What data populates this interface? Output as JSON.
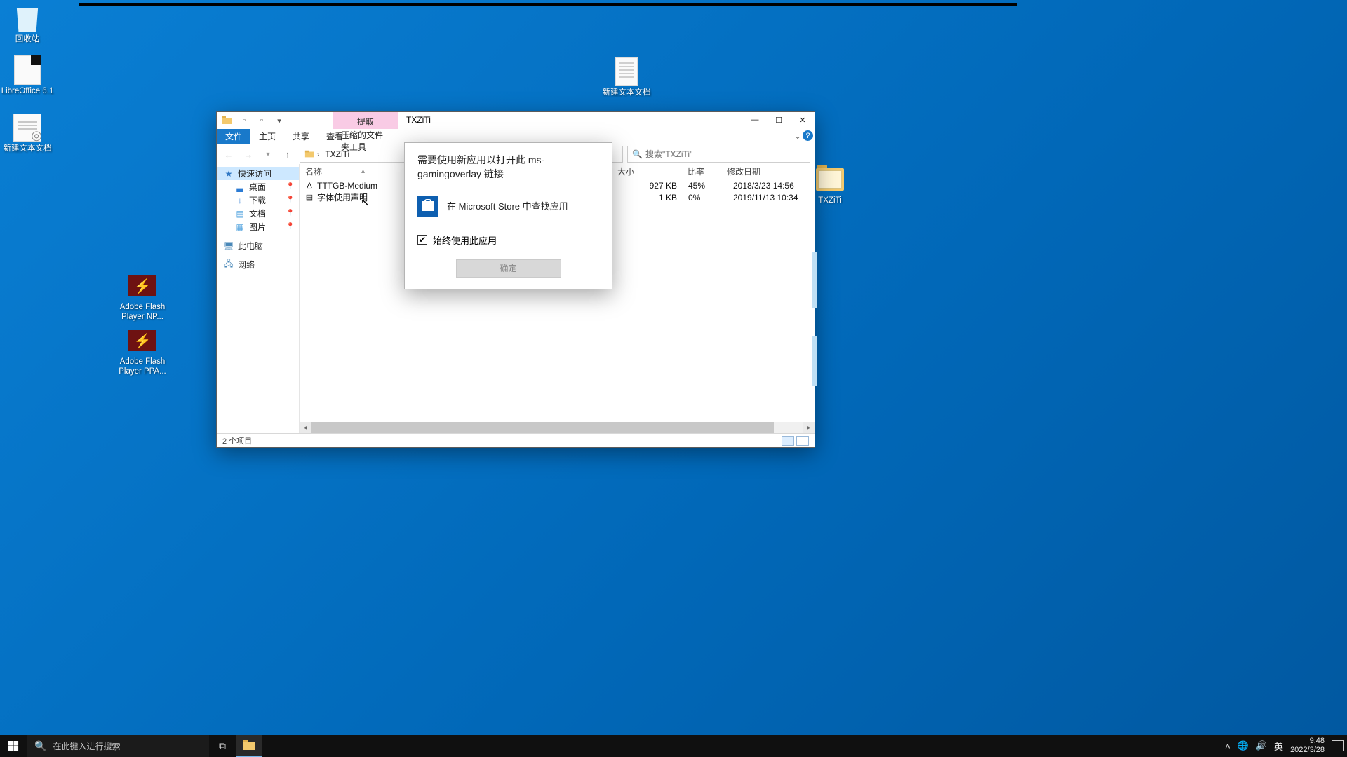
{
  "desktop": {
    "icons": {
      "recycle": "回收站",
      "libreoffice": "LibreOffice 6.1",
      "newtext1": "新建文本文档",
      "flash_np": "Adobe Flash Player NP...",
      "flash_ppa": "Adobe Flash Player PPA...",
      "newtext2": "新建文本文档",
      "txziti": "TXZiTi"
    }
  },
  "explorer": {
    "extract_tab": "提取",
    "title": "TXZiTi",
    "ribbon": {
      "file": "文件",
      "home": "主页",
      "share": "共享",
      "view": "查看",
      "zip": "压缩的文件夹工具"
    },
    "path": {
      "current": "TXZiTi"
    },
    "search_placeholder": "搜索\"TXZiTi\"",
    "columns": {
      "name": "名称",
      "size": "大小",
      "ratio": "比率",
      "date": "修改日期"
    },
    "files": [
      {
        "name": "TTTGB-Medium",
        "size": "927 KB",
        "ratio": "45%",
        "date": "2018/3/23 14:56"
      },
      {
        "name": "字体使用声明",
        "size": "1 KB",
        "ratio": "0%",
        "date": "2019/11/13 10:34"
      }
    ],
    "status": "2 个项目",
    "sidebar": {
      "quick": "快速访问",
      "desktop": "桌面",
      "downloads": "下载",
      "documents": "文档",
      "pictures": "图片",
      "thispc": "此电脑",
      "network": "网络"
    }
  },
  "dialog": {
    "heading": "需要使用新应用以打开此 ms-gamingoverlay 链接",
    "store": "在 Microsoft Store 中查找应用",
    "always": "始终使用此应用",
    "ok": "确定"
  },
  "taskbar": {
    "search_placeholder": "在此键入进行搜索",
    "ime": "英",
    "time": "9:48",
    "date": "2022/3/28"
  }
}
